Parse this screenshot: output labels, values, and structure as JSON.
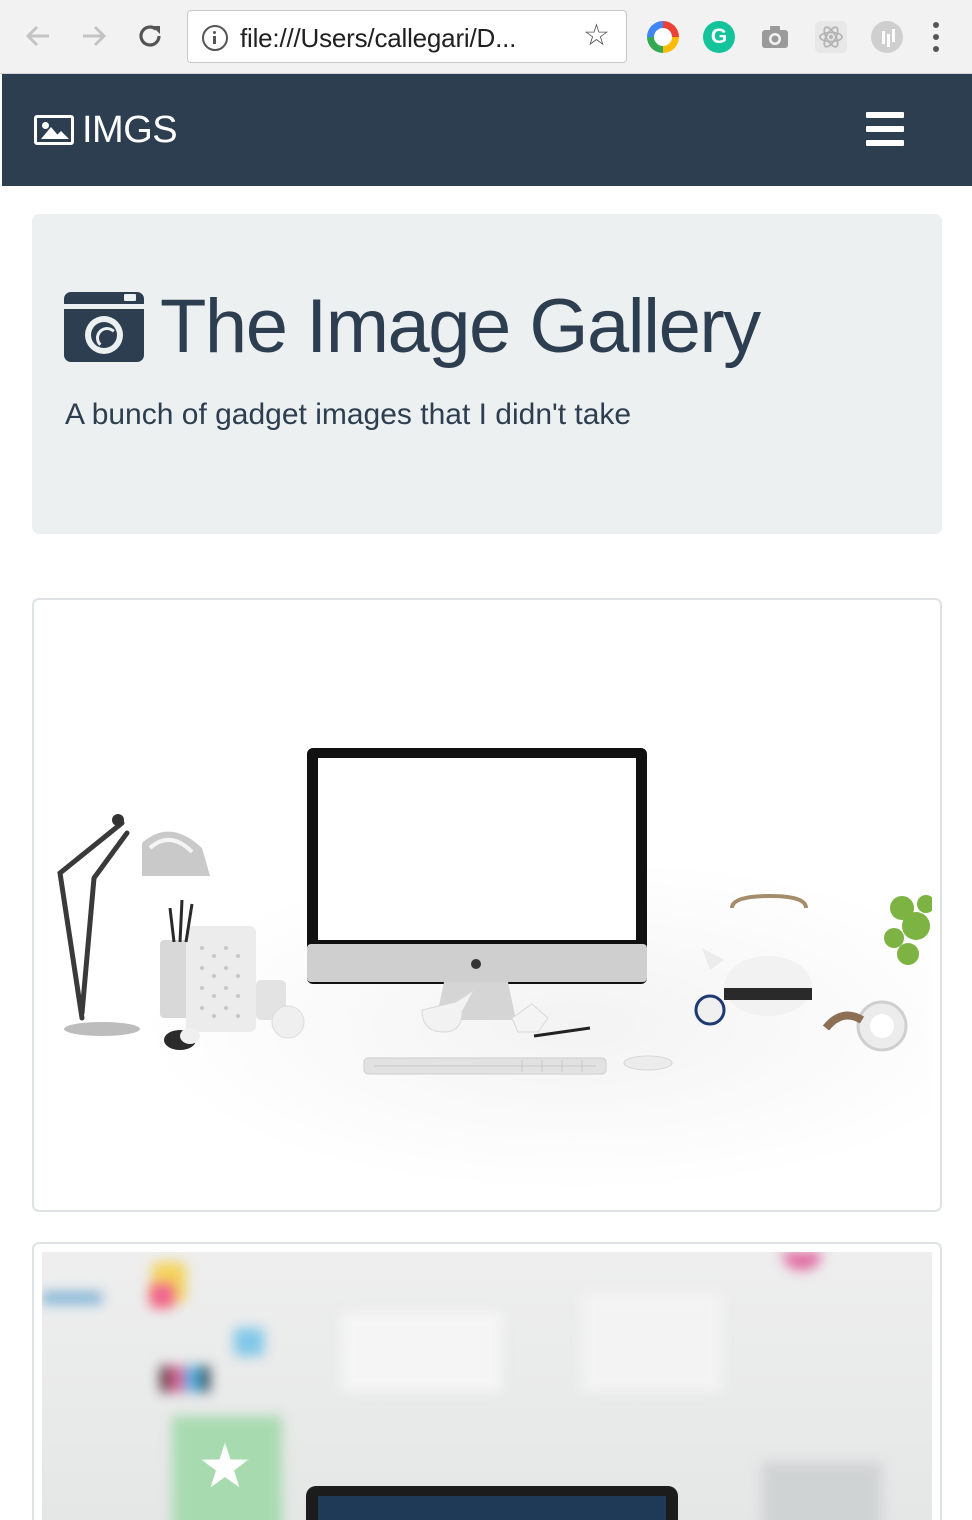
{
  "browser": {
    "url": "file:///Users/callegari/D...",
    "extensions": [
      "compass-extension-icon",
      "grammarly-icon",
      "camera-extension-icon",
      "react-devtools-icon",
      "analytics-extension-icon"
    ]
  },
  "navbar": {
    "brand": "IMGS",
    "brand_icon": "image-icon",
    "toggle_icon": "hamburger-icon",
    "background": "#2c3e50"
  },
  "jumbotron": {
    "title": "The Image Gallery",
    "lead": "A bunch of gadget images that I didn't take",
    "title_icon": "camera-icon",
    "background": "#ecf0f1",
    "text_color": "#2c3e50"
  },
  "gallery": {
    "cards": [
      {
        "image": "desk-with-imac-photo"
      },
      {
        "image": "blurred-laptop-wall-photo"
      }
    ]
  }
}
